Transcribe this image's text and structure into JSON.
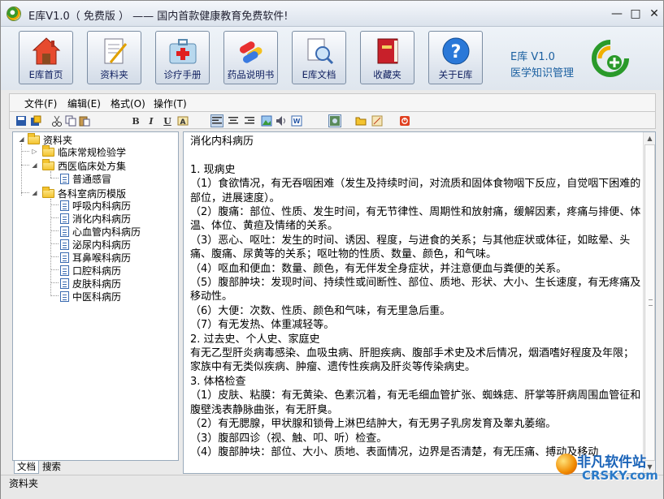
{
  "window": {
    "title": "E库V1.0（ 免费版 ）  —— 国内首款健康教育免费软件!",
    "controls": {
      "minimize": "—",
      "maximize": "□",
      "close": "✕"
    }
  },
  "banner": {
    "buttons": [
      {
        "label": "E库首页",
        "icon": "home-icon"
      },
      {
        "label": "资料夹",
        "icon": "notebook-icon"
      },
      {
        "label": "诊疗手册",
        "icon": "medical-kit-icon"
      },
      {
        "label": "药品说明书",
        "icon": "pills-icon"
      },
      {
        "label": "E库文档",
        "icon": "document-magnifier-icon"
      },
      {
        "label": "收藏夹",
        "icon": "book-icon"
      },
      {
        "label": "关于E库",
        "icon": "help-icon"
      }
    ],
    "brand_line1": "E库 V1.0",
    "brand_line2": "医学知识管理"
  },
  "menu": {
    "items": [
      "文件(F)",
      "编辑(E)",
      "格式(O)",
      "操作(T)"
    ]
  },
  "toolbar": {
    "bold": "B",
    "italic": "I",
    "underline": "U"
  },
  "tree": {
    "root": "资料夹",
    "nodes": [
      {
        "label": "临床常规检验学",
        "type": "folder"
      },
      {
        "label": "西医临床处方集",
        "type": "folder"
      },
      {
        "label": "普通感冒",
        "type": "doc"
      },
      {
        "label": "各科室病历模版",
        "type": "folder"
      },
      {
        "label": "呼吸内科病历",
        "type": "doc"
      },
      {
        "label": "消化内科病历",
        "type": "doc"
      },
      {
        "label": "心血管内科病历",
        "type": "doc"
      },
      {
        "label": "泌尿内科病历",
        "type": "doc"
      },
      {
        "label": "耳鼻喉科病历",
        "type": "doc"
      },
      {
        "label": "口腔科病历",
        "type": "doc"
      },
      {
        "label": "皮肤科病历",
        "type": "doc"
      },
      {
        "label": "中医科病历",
        "type": "doc"
      }
    ],
    "tabs": [
      "文档",
      "搜索"
    ]
  },
  "editor": {
    "lines": [
      "消化内科病历",
      "",
      "1. 现病史",
      "（1）食欲情况，有无吞咽困难（发生及持续时间，对流质和固体食物咽下反应，自觉咽下困难的部位，进展速度）。",
      "（2）腹痛：部位、性质、发生时间，有无节律性、周期性和放射痛，缓解因素，疼痛与排便、体温、体位、黄疸及情绪的关系。",
      "（3）恶心、呕吐：发生的时间、诱因、程度，与进食的关系；与其他症状或体征，如眩晕、头痛、腹痛、尿黄等的关系；呕吐物的性质、数量、颜色，和气味。",
      "（4）呕血和便血：数量、颜色，有无伴发全身症状，并注意便血与粪便的关系。",
      "（5）腹部肿块：发现时间、持续性或间断性、部位、质地、形状、大小、生长速度，有无疼痛及移动性。",
      "（6）大便：次数、性质、颜色和气味，有无里急后重。",
      "（7）有无发热、体重减轻等。",
      "2. 过去史、个人史、家庭史",
      "有无乙型肝炎病毒感染、血吸虫病、肝胆疾病、腹部手术史及术后情况，烟酒嗜好程度及年限；家族中有无类似疾病、肿瘤、遗传性疾病及肝炎等传染病史。",
      "3. 体格检查",
      "（1）皮肤、粘膜：有无黄染、色素沉着，有无毛细血管扩张、蜘蛛痣、肝掌等肝病周围血管征和腹壁浅表静脉曲张，有无肝臭。",
      "（2）有无腮腺，甲状腺和锁骨上淋巴结肿大，有无男子乳房发育及睾丸萎缩。",
      "（3）腹部四诊（视、触、叩、听）检查。",
      "（4）腹部肿块：部位、大小、质地、表面情况，边界是否清楚，有无压痛、搏动及移动"
    ]
  },
  "status": {
    "text": "资料夹"
  },
  "watermark": {
    "line1": "非凡软件站",
    "line2": "CRSKY.com"
  }
}
